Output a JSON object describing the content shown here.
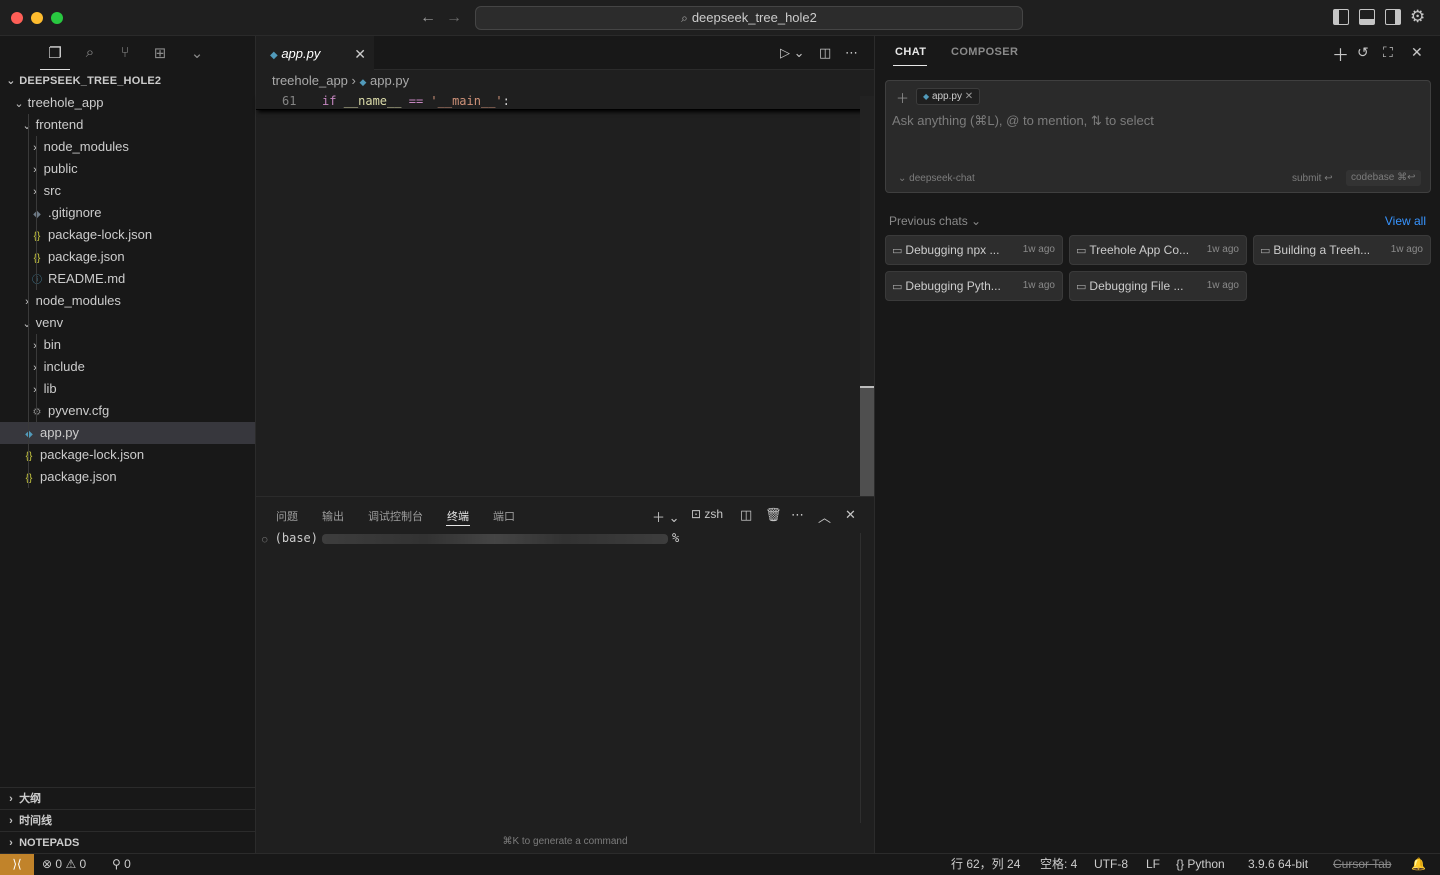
{
  "titlebar": {
    "search_text": "deepseek_tree_hole2",
    "traffic_colors": [
      "#fe5f57",
      "#febc2e",
      "#28c840"
    ]
  },
  "sidebar": {
    "title": "DEEPSEEK_TREE_HOLE2",
    "tree": [
      {
        "label": "treehole_app",
        "type": "folder",
        "open": true,
        "depth": 1
      },
      {
        "label": "frontend",
        "type": "folder",
        "open": true,
        "depth": 2
      },
      {
        "label": "node_modules",
        "type": "folder",
        "open": false,
        "depth": 3
      },
      {
        "label": "public",
        "type": "folder",
        "open": false,
        "depth": 3
      },
      {
        "label": "src",
        "type": "folder",
        "open": false,
        "depth": 3
      },
      {
        "label": ".gitignore",
        "type": "git",
        "depth": 3
      },
      {
        "label": "package-lock.json",
        "type": "json",
        "depth": 3
      },
      {
        "label": "package.json",
        "type": "json",
        "depth": 3
      },
      {
        "label": "README.md",
        "type": "info",
        "depth": 3
      },
      {
        "label": "node_modules",
        "type": "folder",
        "open": false,
        "depth": 2
      },
      {
        "label": "venv",
        "type": "folder",
        "open": true,
        "depth": 2
      },
      {
        "label": "bin",
        "type": "folder",
        "open": false,
        "depth": 3
      },
      {
        "label": "include",
        "type": "folder",
        "open": false,
        "depth": 3
      },
      {
        "label": "lib",
        "type": "folder",
        "open": false,
        "depth": 3
      },
      {
        "label": "pyvenv.cfg",
        "type": "gear",
        "depth": 3
      },
      {
        "label": "app.py",
        "type": "python",
        "depth": 2,
        "selected": true
      },
      {
        "label": "package-lock.json",
        "type": "json",
        "depth": 2
      },
      {
        "label": "package.json",
        "type": "json",
        "depth": 2
      }
    ],
    "sections": [
      "大纲",
      "时间线",
      "NOTEPADS"
    ]
  },
  "editor": {
    "tab_label": "app.py",
    "breadcrumb": [
      "treehole_app",
      "app.py"
    ],
    "line_number": "61",
    "code": {
      "kw": "if",
      "name": "__name__",
      "op": "==",
      "str": "'__main__'",
      "colon": ":"
    }
  },
  "panel": {
    "tabs": [
      "问题",
      "输出",
      "调试控制台",
      "终端",
      "端口"
    ],
    "active_tab": "终端",
    "shell": "zsh",
    "prompt_prefix": "(base)",
    "prompt_suffix": "%",
    "hint": "⌘K to generate a command"
  },
  "chat": {
    "tabs": [
      "CHAT",
      "COMPOSER"
    ],
    "pill": "app.py",
    "placeholder": "Ask anything (⌘L), @ to mention, ⇅ to select",
    "model": "deepseek-chat",
    "submit": "submit ↩",
    "codebase": "codebase ⌘↩",
    "previous_label": "Previous chats",
    "view_all": "View all",
    "previous": [
      {
        "title": "Debugging npx ...",
        "ago": "1w ago"
      },
      {
        "title": "Treehole App Co...",
        "ago": "1w ago"
      },
      {
        "title": "Building a Treeh...",
        "ago": "1w ago"
      },
      {
        "title": "Debugging Pyth...",
        "ago": "1w ago"
      },
      {
        "title": "Debugging File ...",
        "ago": "1w ago"
      }
    ]
  },
  "status": {
    "errors": "0",
    "warnings": "0",
    "ports": "0",
    "position": "行 62，列 24",
    "spaces": "空格: 4",
    "encoding": "UTF-8",
    "eol": "LF",
    "language": "Python",
    "interpreter": "3.9.6 64-bit",
    "cursor_tab": "Cursor Tab",
    "accent": "#c1832a"
  }
}
